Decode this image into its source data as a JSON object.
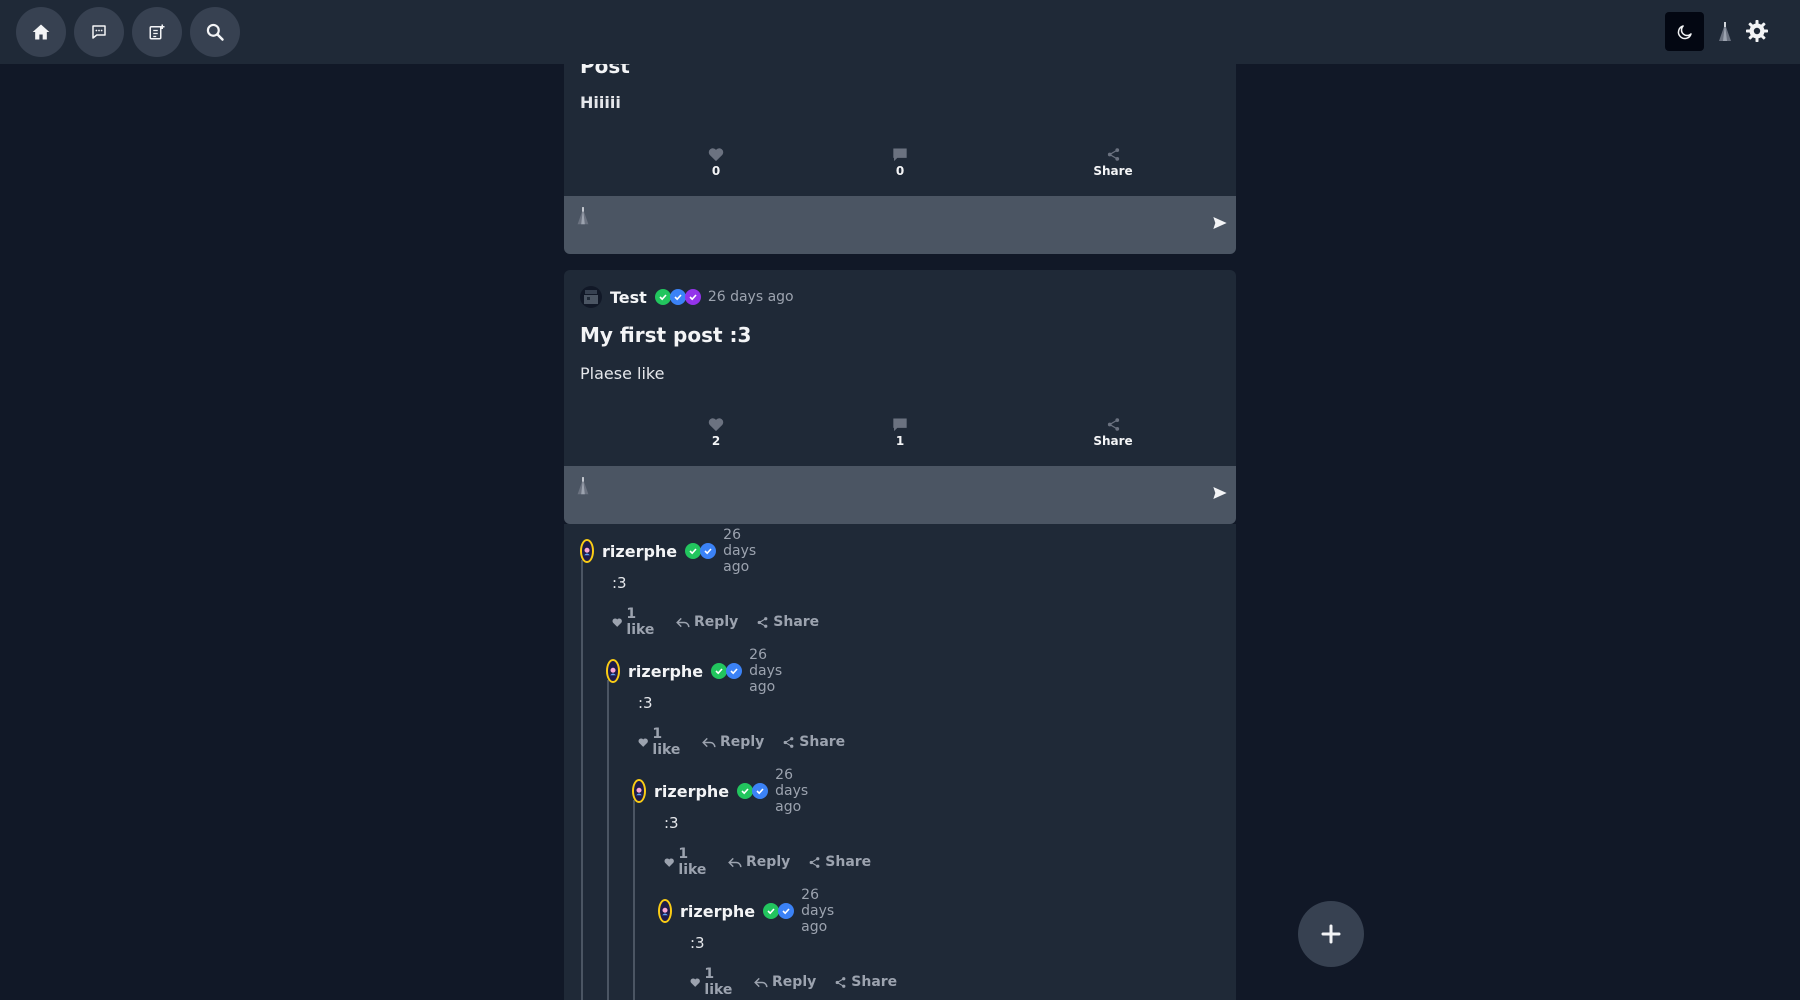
{
  "topbar": {
    "nav": [
      {
        "name": "home-icon",
        "label": "Home"
      },
      {
        "name": "chat-icon",
        "label": "Messages"
      },
      {
        "name": "new-post-icon",
        "label": "New post"
      },
      {
        "name": "search-icon",
        "label": "Search"
      }
    ],
    "theme_icon": "moon-icon",
    "settings_icon": "gear-icon"
  },
  "posts": [
    {
      "title": "Post",
      "body": "Hiiiii",
      "likes": "0",
      "comments": "0",
      "share_label": "Share",
      "composer_placeholder": ""
    },
    {
      "author": "Test",
      "badges": [
        "green-check",
        "blue-check",
        "purple-check"
      ],
      "time": "26 days ago",
      "title": "My first post :3",
      "body": "Plaese like",
      "likes": "2",
      "comments": "1",
      "share_label": "Share",
      "composer_placeholder": "",
      "replies": [
        {
          "author": "rizerphe",
          "time": "26 days ago",
          "text": ":3",
          "likes": "1 like",
          "reply_label": "Reply",
          "share_label": "Share"
        },
        {
          "author": "rizerphe",
          "time": "26 days ago",
          "text": ":3",
          "likes": "1 like",
          "reply_label": "Reply",
          "share_label": "Share"
        },
        {
          "author": "rizerphe",
          "time": "26 days ago",
          "text": ":3",
          "likes": "1 like",
          "reply_label": "Reply",
          "share_label": "Share"
        },
        {
          "author": "rizerphe",
          "time": "26 days ago",
          "text": ":3",
          "likes": "1 like",
          "reply_label": "Reply",
          "share_label": "Share"
        }
      ]
    }
  ],
  "fab_icon": "plus-icon",
  "colors": {
    "page_bg": "#111827",
    "card_bg": "#1f2937",
    "composer_bg": "#4b5563",
    "badge_green": "#22c55e",
    "badge_blue": "#3b82f6",
    "badge_purple": "#9333ea",
    "muted_text": "#9ca3af"
  }
}
